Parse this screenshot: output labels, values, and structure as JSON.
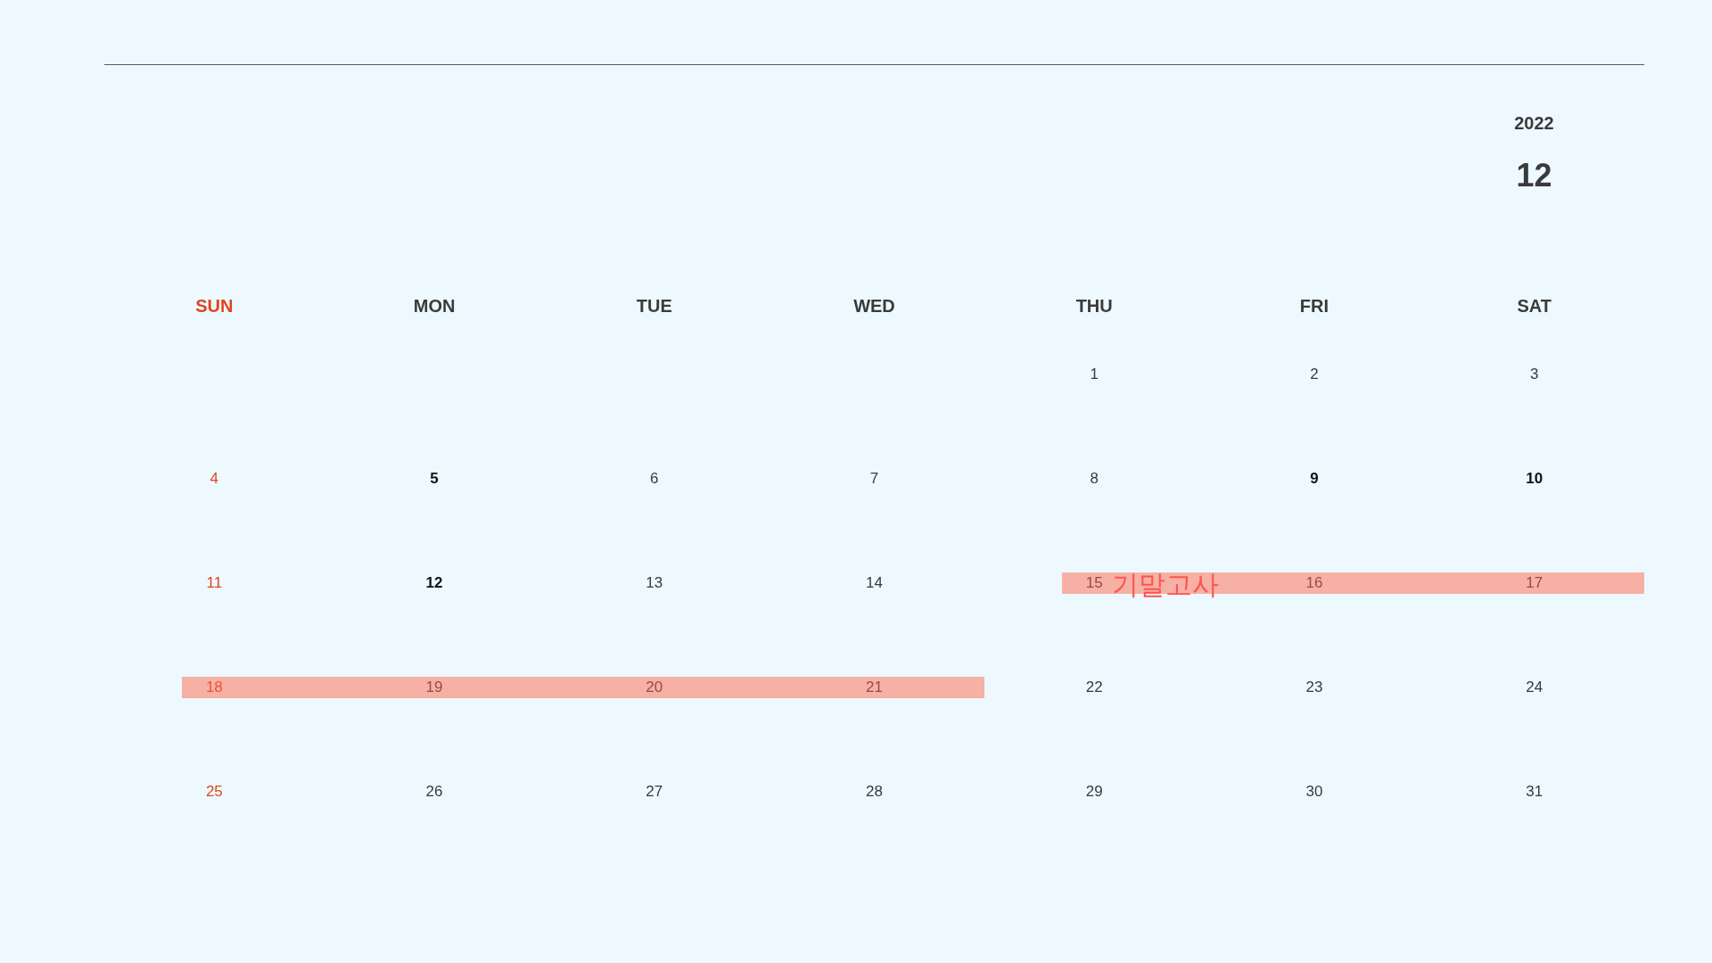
{
  "year": "2022",
  "month": "12",
  "weekdays": [
    {
      "label": "SUN",
      "kind": "sunday"
    },
    {
      "label": "MON",
      "kind": "normal"
    },
    {
      "label": "TUE",
      "kind": "normal"
    },
    {
      "label": "WED",
      "kind": "normal"
    },
    {
      "label": "THU",
      "kind": "normal"
    },
    {
      "label": "FRI",
      "kind": "normal"
    },
    {
      "label": "SAT",
      "kind": "normal"
    }
  ],
  "weeks": [
    {
      "days": [
        {
          "label": "1",
          "kind": "normal",
          "highlighted": false
        },
        {
          "label": "2",
          "kind": "normal",
          "highlighted": false
        },
        {
          "label": "3",
          "kind": "normal",
          "highlighted": false
        }
      ]
    },
    {
      "days": [
        {
          "label": "4",
          "kind": "sunday",
          "highlighted": false
        },
        {
          "label": "5",
          "kind": "strong",
          "highlighted": false
        },
        {
          "label": "6",
          "kind": "normal",
          "highlighted": false
        },
        {
          "label": "7",
          "kind": "normal",
          "highlighted": false
        },
        {
          "label": "8",
          "kind": "normal",
          "highlighted": false
        },
        {
          "label": "9",
          "kind": "strong",
          "highlighted": false
        },
        {
          "label": "10",
          "kind": "strong",
          "highlighted": false
        }
      ]
    },
    {
      "days": [
        {
          "label": "11",
          "kind": "sunday",
          "highlighted": false
        },
        {
          "label": "12",
          "kind": "strong",
          "highlighted": false
        },
        {
          "label": "13",
          "kind": "normal",
          "highlighted": false
        },
        {
          "label": "14",
          "kind": "normal",
          "highlighted": false
        },
        {
          "label": "15",
          "kind": "normal",
          "highlighted": true,
          "event": "기말고사"
        },
        {
          "label": "16",
          "kind": "normal",
          "highlighted": true
        },
        {
          "label": "17",
          "kind": "normal",
          "highlighted": true
        }
      ]
    },
    {
      "days": [
        {
          "label": "18",
          "kind": "sunday",
          "highlighted": true
        },
        {
          "label": "19",
          "kind": "normal",
          "highlighted": true
        },
        {
          "label": "20",
          "kind": "normal",
          "highlighted": true
        },
        {
          "label": "21",
          "kind": "normal",
          "highlighted": true
        },
        {
          "label": "22",
          "kind": "normal",
          "highlighted": false
        },
        {
          "label": "23",
          "kind": "normal",
          "highlighted": false
        },
        {
          "label": "24",
          "kind": "normal",
          "highlighted": false
        }
      ]
    },
    {
      "days": [
        {
          "label": "25",
          "kind": "sunday",
          "highlighted": false
        },
        {
          "label": "26",
          "kind": "normal",
          "highlighted": false
        },
        {
          "label": "27",
          "kind": "normal",
          "highlighted": false
        },
        {
          "label": "28",
          "kind": "normal",
          "highlighted": false
        },
        {
          "label": "29",
          "kind": "normal",
          "highlighted": false
        },
        {
          "label": "30",
          "kind": "normal",
          "highlighted": false
        },
        {
          "label": "31",
          "kind": "normal",
          "highlighted": false
        }
      ]
    }
  ]
}
